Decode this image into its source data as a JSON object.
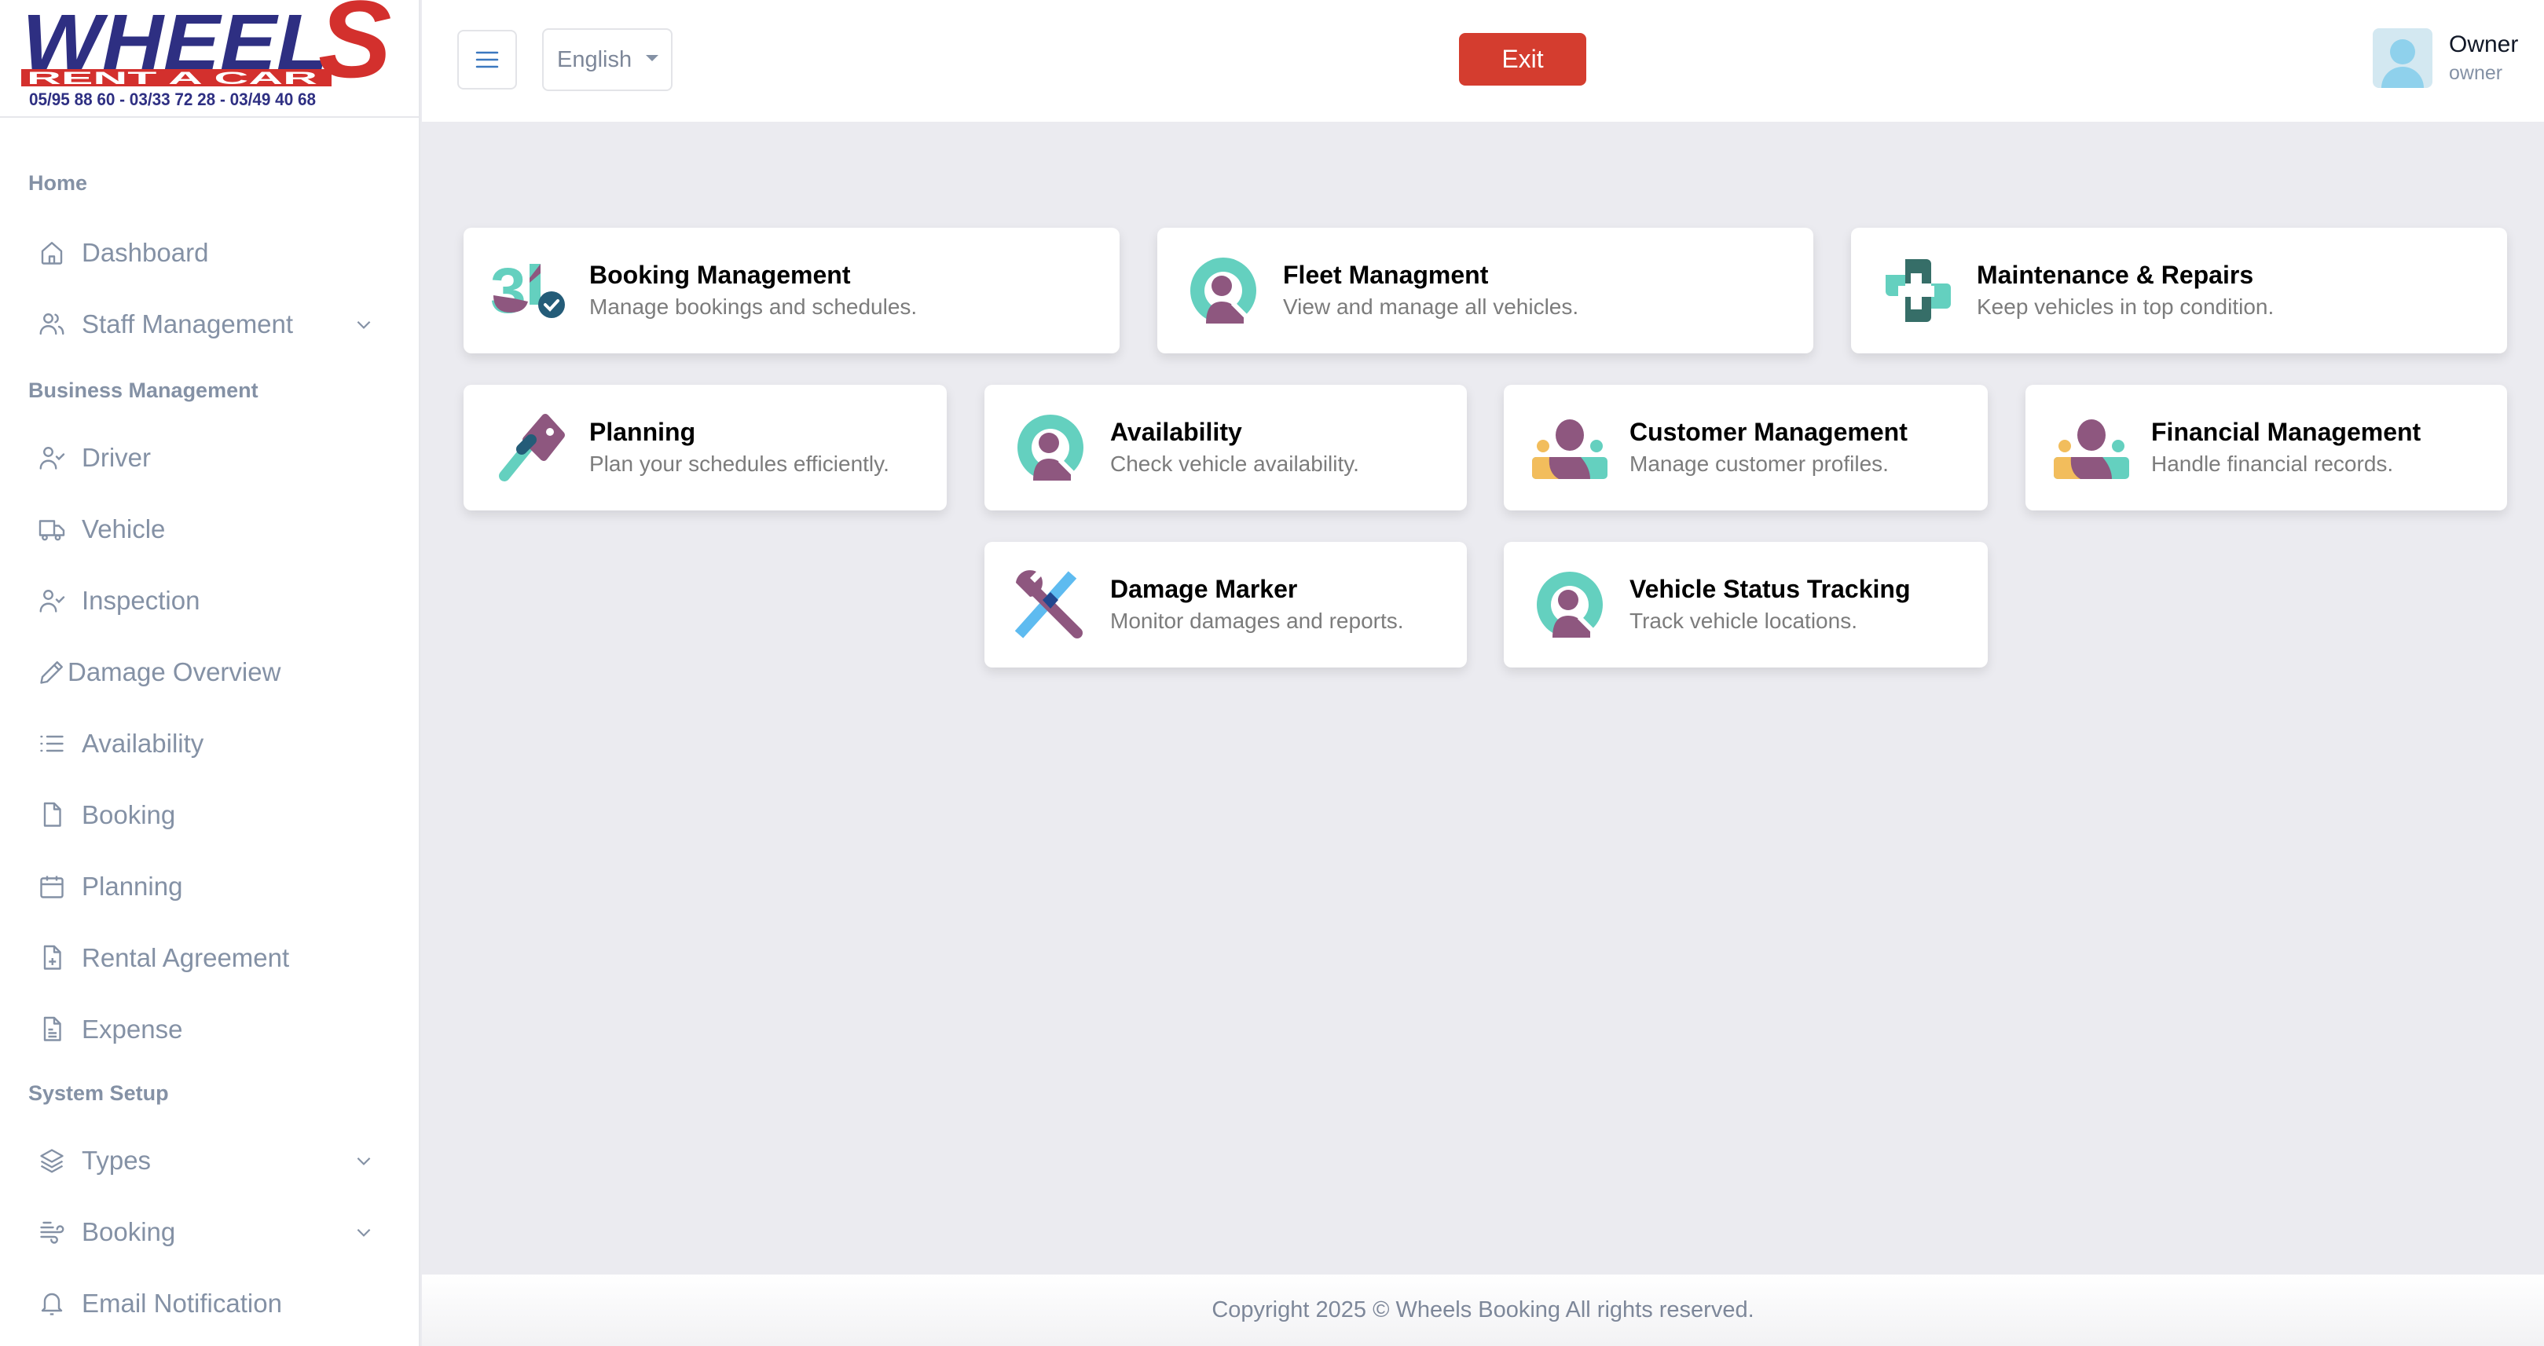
{
  "brand": {
    "logo_word": "WHEELS",
    "logo_tagline": "RENT A CAR",
    "logo_phones": "05/95 88 60 - 03/33 72 28 - 03/49 40 68",
    "colors": {
      "navy": "#2e2f82",
      "red": "#d3302d"
    }
  },
  "header": {
    "menu_icon": "hamburger-icon",
    "language": {
      "selected": "English"
    },
    "exit_label": "Exit",
    "user": {
      "name": "Owner",
      "role": "owner"
    }
  },
  "sidebar": {
    "sections": [
      {
        "label": "Home"
      },
      {
        "label": "Business Management"
      },
      {
        "label": "System Setup"
      }
    ],
    "items": [
      {
        "label": "Dashboard",
        "icon": "home-icon"
      },
      {
        "label": "Staff Management",
        "icon": "users-icon",
        "expandable": true
      },
      {
        "label": "Driver",
        "icon": "user-check-icon"
      },
      {
        "label": "Vehicle",
        "icon": "truck-icon"
      },
      {
        "label": "Inspection",
        "icon": "user-check-icon"
      },
      {
        "label": "Damage Overview",
        "icon": "pencil-icon"
      },
      {
        "label": "Availability",
        "icon": "list-icon"
      },
      {
        "label": "Booking",
        "icon": "file-icon"
      },
      {
        "label": "Planning",
        "icon": "calendar-icon"
      },
      {
        "label": "Rental Agreement",
        "icon": "file-plus-icon"
      },
      {
        "label": "Expense",
        "icon": "file-text-icon"
      },
      {
        "label": "Types",
        "icon": "layers-icon",
        "expandable": true
      },
      {
        "label": "Booking",
        "icon": "wind-icon",
        "expandable": true
      },
      {
        "label": "Email Notification",
        "icon": "bell-icon"
      }
    ]
  },
  "cards": [
    {
      "title": "Booking Management",
      "desc": "Manage bookings and schedules.",
      "icon": "calendar-check-icon"
    },
    {
      "title": "Fleet Managment",
      "desc": "View and manage all vehicles.",
      "icon": "user-search-icon"
    },
    {
      "title": "Maintenance & Repairs",
      "desc": "Keep vehicles in top condition.",
      "icon": "medical-cross-icon"
    },
    {
      "title": "Planning",
      "desc": "Plan your schedules efficiently.",
      "icon": "key-icon"
    },
    {
      "title": "Availability",
      "desc": "Check vehicle availability.",
      "icon": "user-search-icon"
    },
    {
      "title": "Customer Management",
      "desc": "Manage customer profiles.",
      "icon": "group-icon"
    },
    {
      "title": "Financial Management",
      "desc": "Handle financial records.",
      "icon": "group-icon"
    },
    {
      "title": "Damage Marker",
      "desc": "Monitor damages and reports.",
      "icon": "tools-icon"
    },
    {
      "title": "Vehicle Status Tracking",
      "desc": "Track vehicle locations.",
      "icon": "user-search-icon"
    }
  ],
  "footer": {
    "text": "Copyright 2025 © Wheels Booking All rights reserved."
  },
  "palette": {
    "teal": "#64d0bf",
    "plum": "#8e577f",
    "navy_teal": "#245c78",
    "dark_green": "#366e68",
    "amber": "#f2bd5c",
    "sky": "#5ebbf0",
    "exit_red": "#d43d2f"
  }
}
